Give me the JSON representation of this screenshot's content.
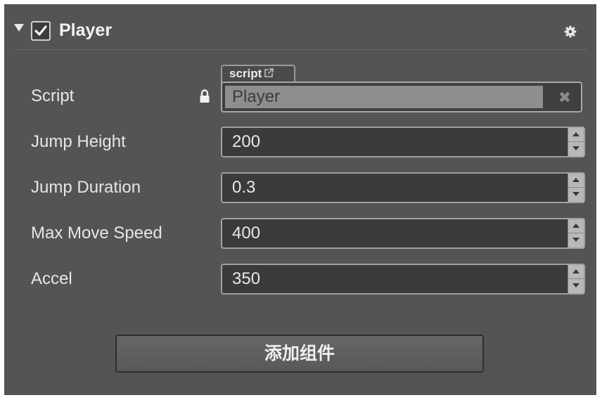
{
  "component": {
    "title": "Player",
    "enabled": true,
    "foldout_icon": "triangle-down-icon",
    "settings_icon": "gear-icon"
  },
  "script": {
    "label": "Script",
    "lock_icon": "lock-icon",
    "tab_label": "script",
    "tab_icon": "external-link-icon",
    "value": "Player",
    "clear_label": "✖"
  },
  "properties": [
    {
      "label": "Jump Height",
      "value": "200"
    },
    {
      "label": "Jump Duration",
      "value": "0.3"
    },
    {
      "label": "Max Move Speed",
      "value": "400"
    },
    {
      "label": "Accel",
      "value": "350"
    }
  ],
  "add_component_label": "添加组件",
  "colors": {
    "panel_bg": "#545454",
    "field_bg": "#3b3b3b",
    "text": "#e6e6e6"
  }
}
